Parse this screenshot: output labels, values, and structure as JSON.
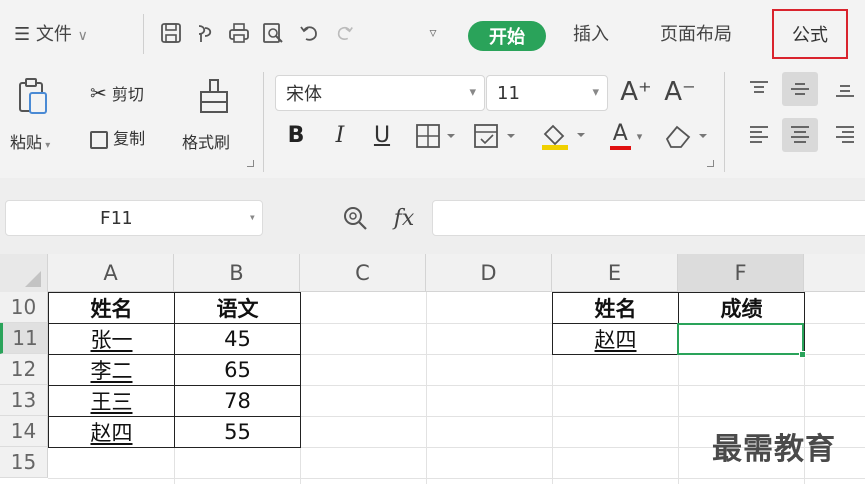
{
  "menu": {
    "hamburger_label": "文件",
    "tabs": [
      {
        "label": "开始"
      },
      {
        "label": "插入"
      },
      {
        "label": "页面布局"
      },
      {
        "label": "公式"
      }
    ]
  },
  "ribbon": {
    "paste_label": "粘贴",
    "cut_label": "剪切",
    "copy_label": "复制",
    "format_painter_label": "格式刷",
    "font_name": "宋体",
    "font_size": "11",
    "bold": "B",
    "italic": "I",
    "underline": "U",
    "font_color_letter": "A",
    "grow_font": "A⁺",
    "shrink_font": "A⁻"
  },
  "formula_bar": {
    "name_box": "F11",
    "fx_label": "fx",
    "formula": ""
  },
  "grid": {
    "columns": [
      "A",
      "B",
      "C",
      "D",
      "E",
      "F"
    ],
    "rows": [
      "10",
      "11",
      "12",
      "13",
      "14",
      "15"
    ],
    "selected_cell": "F11",
    "table1": {
      "headers": [
        "姓名",
        "语文"
      ],
      "rows": [
        [
          "张一",
          "45"
        ],
        [
          "李二",
          "65"
        ],
        [
          "王三",
          "78"
        ],
        [
          "赵四",
          "55"
        ]
      ]
    },
    "table2": {
      "headers": [
        "姓名",
        "成绩"
      ],
      "rows": [
        [
          "赵四",
          ""
        ]
      ]
    }
  },
  "watermark": "最需教育",
  "colors": {
    "accent_green": "#2aa35a",
    "highlight_red": "#d9232d"
  }
}
